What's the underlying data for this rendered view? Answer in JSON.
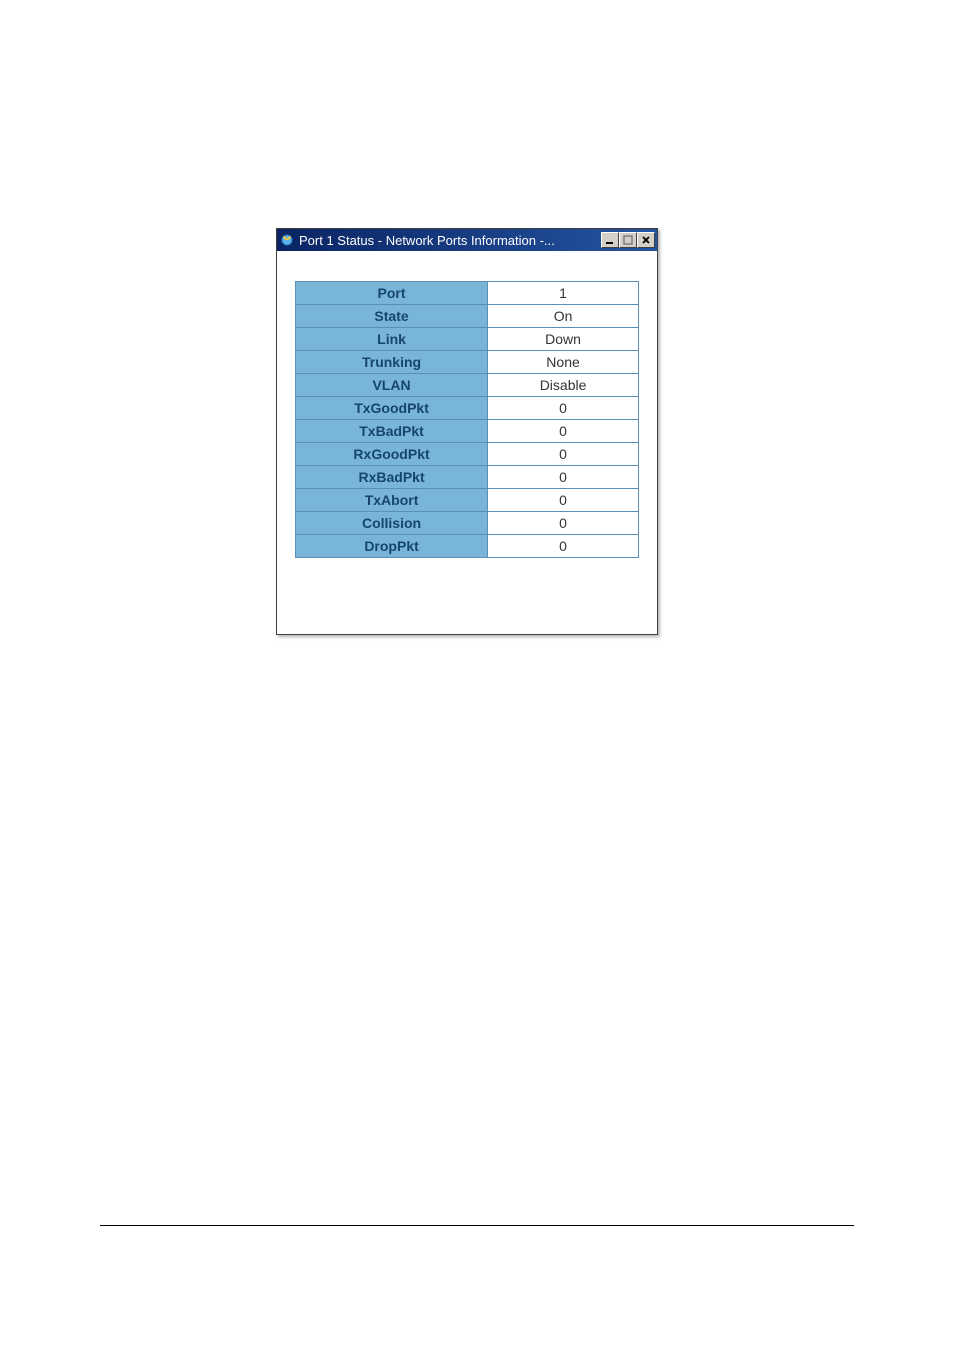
{
  "window": {
    "title": "Port 1 Status - Network Ports Information -..."
  },
  "rows": [
    {
      "label": "Port",
      "value": "1"
    },
    {
      "label": "State",
      "value": "On"
    },
    {
      "label": "Link",
      "value": "Down"
    },
    {
      "label": "Trunking",
      "value": "None"
    },
    {
      "label": "VLAN",
      "value": "Disable"
    },
    {
      "label": "TxGoodPkt",
      "value": "0"
    },
    {
      "label": "TxBadPkt",
      "value": "0"
    },
    {
      "label": "RxGoodPkt",
      "value": "0"
    },
    {
      "label": "RxBadPkt",
      "value": "0"
    },
    {
      "label": "TxAbort",
      "value": "0"
    },
    {
      "label": "Collision",
      "value": "0"
    },
    {
      "label": "DropPkt",
      "value": "0"
    }
  ]
}
